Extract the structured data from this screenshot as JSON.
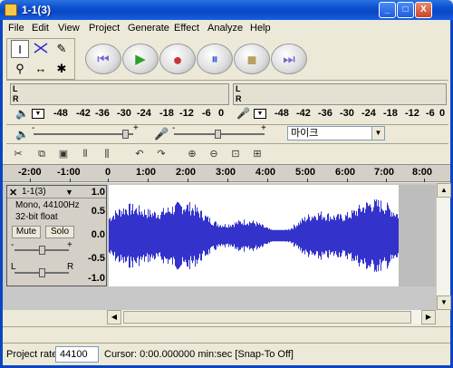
{
  "window": {
    "title": "1-1(3)",
    "minimize": "_",
    "maximize": "□",
    "close": "X"
  },
  "menu": [
    "File",
    "Edit",
    "View",
    "Project",
    "Generate",
    "Effect",
    "Analyze",
    "Help"
  ],
  "transport": {
    "rewind": "⏮",
    "play": "▶",
    "record": "●",
    "pause": "⏸",
    "stop": "■",
    "ffwd": "⏭"
  },
  "meters": {
    "left_channel": "L",
    "right_channel": "R",
    "scale": [
      "-48",
      "-42",
      "-36",
      "-30",
      "-24",
      "-18",
      "-12",
      "-6",
      "0"
    ]
  },
  "mixer": {
    "input_source": "마이크",
    "minus": "-",
    "plus": "+"
  },
  "ruler": {
    "labels": [
      "-2:00",
      "-1:00",
      "0",
      "1:00",
      "2:00",
      "3:00",
      "4:00",
      "5:00",
      "6:00",
      "7:00",
      "8:00"
    ]
  },
  "track": {
    "name": "1-1(3)",
    "format": "Mono, 44100Hz",
    "bitdepth": "32-bit float",
    "mute": "Mute",
    "solo": "Solo",
    "gain_minus": "-",
    "gain_plus": "+",
    "pan_left": "L",
    "pan_right": "R",
    "scale": [
      "1.0",
      "0.5",
      "0.0",
      "-0.5",
      "-1.0"
    ]
  },
  "status": {
    "project_rate_label": "Project rate:",
    "project_rate_value": "44100",
    "cursor_text": "Cursor: 0:00.000000 min:sec  [Snap-To Off]"
  },
  "colors": {
    "waveform": "#3333cc",
    "titlebar": "#0a46c2"
  }
}
